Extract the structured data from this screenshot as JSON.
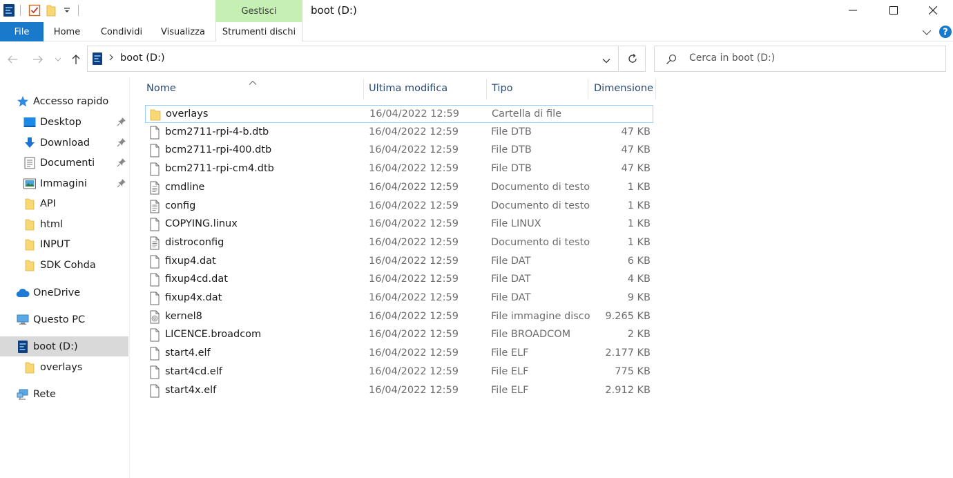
{
  "window": {
    "title": "boot (D:)",
    "context_group": "Gestisci"
  },
  "ribbon": {
    "tabs": [
      {
        "label": "File"
      },
      {
        "label": "Home"
      },
      {
        "label": "Condividi"
      },
      {
        "label": "Visualizza"
      },
      {
        "label": "Strumenti dischi"
      }
    ]
  },
  "address": {
    "path": "boot (D:)"
  },
  "search": {
    "placeholder": "Cerca in boot (D:)"
  },
  "sidebar": {
    "items": [
      {
        "label": "Accesso rapido",
        "icon": "star-icon"
      },
      {
        "label": "Desktop",
        "icon": "desktop-icon",
        "pinned": true
      },
      {
        "label": "Download",
        "icon": "download-icon",
        "pinned": true
      },
      {
        "label": "Documenti",
        "icon": "documents-icon",
        "pinned": true
      },
      {
        "label": "Immagini",
        "icon": "pictures-icon",
        "pinned": true
      },
      {
        "label": "API",
        "icon": "folder-icon"
      },
      {
        "label": "html",
        "icon": "folder-icon"
      },
      {
        "label": "INPUT",
        "icon": "folder-icon"
      },
      {
        "label": "SDK Cohda",
        "icon": "folder-icon"
      },
      {
        "label": "OneDrive",
        "icon": "cloud-icon"
      },
      {
        "label": "Questo PC",
        "icon": "computer-icon"
      },
      {
        "label": "boot (D:)",
        "icon": "drive-icon",
        "selected": true
      },
      {
        "label": "overlays",
        "icon": "folder-icon"
      },
      {
        "label": "Rete",
        "icon": "network-icon"
      }
    ]
  },
  "columns": {
    "name": "Nome",
    "modified": "Ultima modifica",
    "type": "Tipo",
    "size": "Dimensione"
  },
  "files": [
    {
      "name": "overlays",
      "modified": "16/04/2022 12:59",
      "type": "Cartella di file",
      "size": "",
      "icon": "folder-icon"
    },
    {
      "name": "bcm2711-rpi-4-b.dtb",
      "modified": "16/04/2022 12:59",
      "type": "File DTB",
      "size": "47 KB",
      "icon": "file-icon"
    },
    {
      "name": "bcm2711-rpi-400.dtb",
      "modified": "16/04/2022 12:59",
      "type": "File DTB",
      "size": "47 KB",
      "icon": "file-icon"
    },
    {
      "name": "bcm2711-rpi-cm4.dtb",
      "modified": "16/04/2022 12:59",
      "type": "File DTB",
      "size": "47 KB",
      "icon": "file-icon"
    },
    {
      "name": "cmdline",
      "modified": "16/04/2022 12:59",
      "type": "Documento di testo",
      "size": "1 KB",
      "icon": "text-file-icon"
    },
    {
      "name": "config",
      "modified": "16/04/2022 12:59",
      "type": "Documento di testo",
      "size": "1 KB",
      "icon": "text-file-icon"
    },
    {
      "name": "COPYING.linux",
      "modified": "16/04/2022 12:59",
      "type": "File LINUX",
      "size": "1 KB",
      "icon": "file-icon"
    },
    {
      "name": "distroconfig",
      "modified": "16/04/2022 12:59",
      "type": "Documento di testo",
      "size": "1 KB",
      "icon": "text-file-icon"
    },
    {
      "name": "fixup4.dat",
      "modified": "16/04/2022 12:59",
      "type": "File DAT",
      "size": "6 KB",
      "icon": "file-icon"
    },
    {
      "name": "fixup4cd.dat",
      "modified": "16/04/2022 12:59",
      "type": "File DAT",
      "size": "4 KB",
      "icon": "file-icon"
    },
    {
      "name": "fixup4x.dat",
      "modified": "16/04/2022 12:59",
      "type": "File DAT",
      "size": "9 KB",
      "icon": "file-icon"
    },
    {
      "name": "kernel8",
      "modified": "16/04/2022 12:59",
      "type": "File immagine disco",
      "size": "9.265 KB",
      "icon": "disk-image-icon"
    },
    {
      "name": "LICENCE.broadcom",
      "modified": "16/04/2022 12:59",
      "type": "File BROADCOM",
      "size": "2 KB",
      "icon": "file-icon"
    },
    {
      "name": "start4.elf",
      "modified": "16/04/2022 12:59",
      "type": "File ELF",
      "size": "2.177 KB",
      "icon": "file-icon"
    },
    {
      "name": "start4cd.elf",
      "modified": "16/04/2022 12:59",
      "type": "File ELF",
      "size": "775 KB",
      "icon": "file-icon"
    },
    {
      "name": "start4x.elf",
      "modified": "16/04/2022 12:59",
      "type": "File ELF",
      "size": "2.912 KB",
      "icon": "file-icon"
    }
  ],
  "colors": {
    "file_tab": "#1979ca",
    "context_tab": "#c6efb4",
    "selected_row_border": "#99d1ff",
    "selected_nav": "#d9d9d9",
    "folder": "#f8d775"
  }
}
